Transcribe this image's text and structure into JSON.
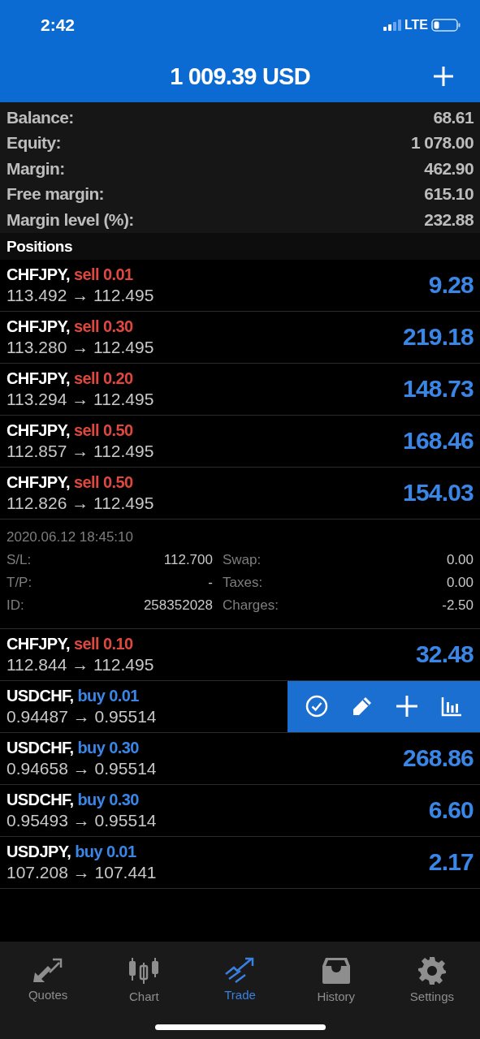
{
  "status_bar": {
    "time": "2:42",
    "network": "LTE"
  },
  "header": {
    "title": "1 009.39 USD"
  },
  "summary": [
    {
      "label": "Balance:",
      "value": "68.61"
    },
    {
      "label": "Equity:",
      "value": "1 078.00"
    },
    {
      "label": "Margin:",
      "value": "462.90"
    },
    {
      "label": "Free margin:",
      "value": "615.10"
    },
    {
      "label": "Margin level (%):",
      "value": "232.88"
    }
  ],
  "positions_title": "Positions",
  "positions": [
    {
      "symbol": "CHFJPY,",
      "kind": "sell",
      "order": "sell 0.01",
      "prices": "113.492 → 112.495",
      "profit": "9.28",
      "actions_shown": false
    },
    {
      "symbol": "CHFJPY,",
      "kind": "sell",
      "order": "sell 0.30",
      "prices": "113.280 → 112.495",
      "profit": "219.18",
      "actions_shown": false
    },
    {
      "symbol": "CHFJPY,",
      "kind": "sell",
      "order": "sell 0.20",
      "prices": "113.294 → 112.495",
      "profit": "148.73",
      "actions_shown": false
    },
    {
      "symbol": "CHFJPY,",
      "kind": "sell",
      "order": "sell 0.50",
      "prices": "112.857 → 112.495",
      "profit": "168.46",
      "actions_shown": false
    },
    {
      "symbol": "CHFJPY,",
      "kind": "sell",
      "order": "sell 0.50",
      "prices": "112.826 → 112.495",
      "profit": "154.03",
      "actions_shown": false,
      "details": {
        "time": "2020.06.12 18:45:10",
        "columns": [
          [
            {
              "label": "S/L:",
              "value": "112.700"
            },
            {
              "label": "T/P:",
              "value": "-"
            },
            {
              "label": "ID:",
              "value": "258352028"
            }
          ],
          [
            {
              "label": "Swap:",
              "value": "0.00"
            },
            {
              "label": "Taxes:",
              "value": "0.00"
            },
            {
              "label": "Charges:",
              "value": "-2.50"
            }
          ]
        ]
      }
    },
    {
      "symbol": "CHFJPY,",
      "kind": "sell",
      "order": "sell 0.10",
      "prices": "112.844 → 112.495",
      "profit": "32.48",
      "actions_shown": false
    },
    {
      "symbol": "USDCHF,",
      "kind": "buy",
      "order": "buy 0.01",
      "prices": "0.94487 → 0.95514",
      "actions_shown": true
    },
    {
      "symbol": "USDCHF,",
      "kind": "buy",
      "order": "buy 0.30",
      "prices": "0.94658 → 0.95514",
      "profit": "268.86",
      "actions_shown": false
    },
    {
      "symbol": "USDCHF,",
      "kind": "buy",
      "order": "buy 0.30",
      "prices": "0.95493 → 0.95514",
      "profit": "6.60",
      "actions_shown": false
    },
    {
      "symbol": "USDJPY,",
      "kind": "buy",
      "order": "buy 0.01",
      "prices": "107.208 → 107.441",
      "profit": "2.17",
      "actions_shown": false
    }
  ],
  "tabs": [
    {
      "label": "Quotes",
      "selected": false
    },
    {
      "label": "Chart",
      "selected": false
    },
    {
      "label": "Trade",
      "selected": true
    },
    {
      "label": "History",
      "selected": false
    },
    {
      "label": "Settings",
      "selected": false
    }
  ]
}
